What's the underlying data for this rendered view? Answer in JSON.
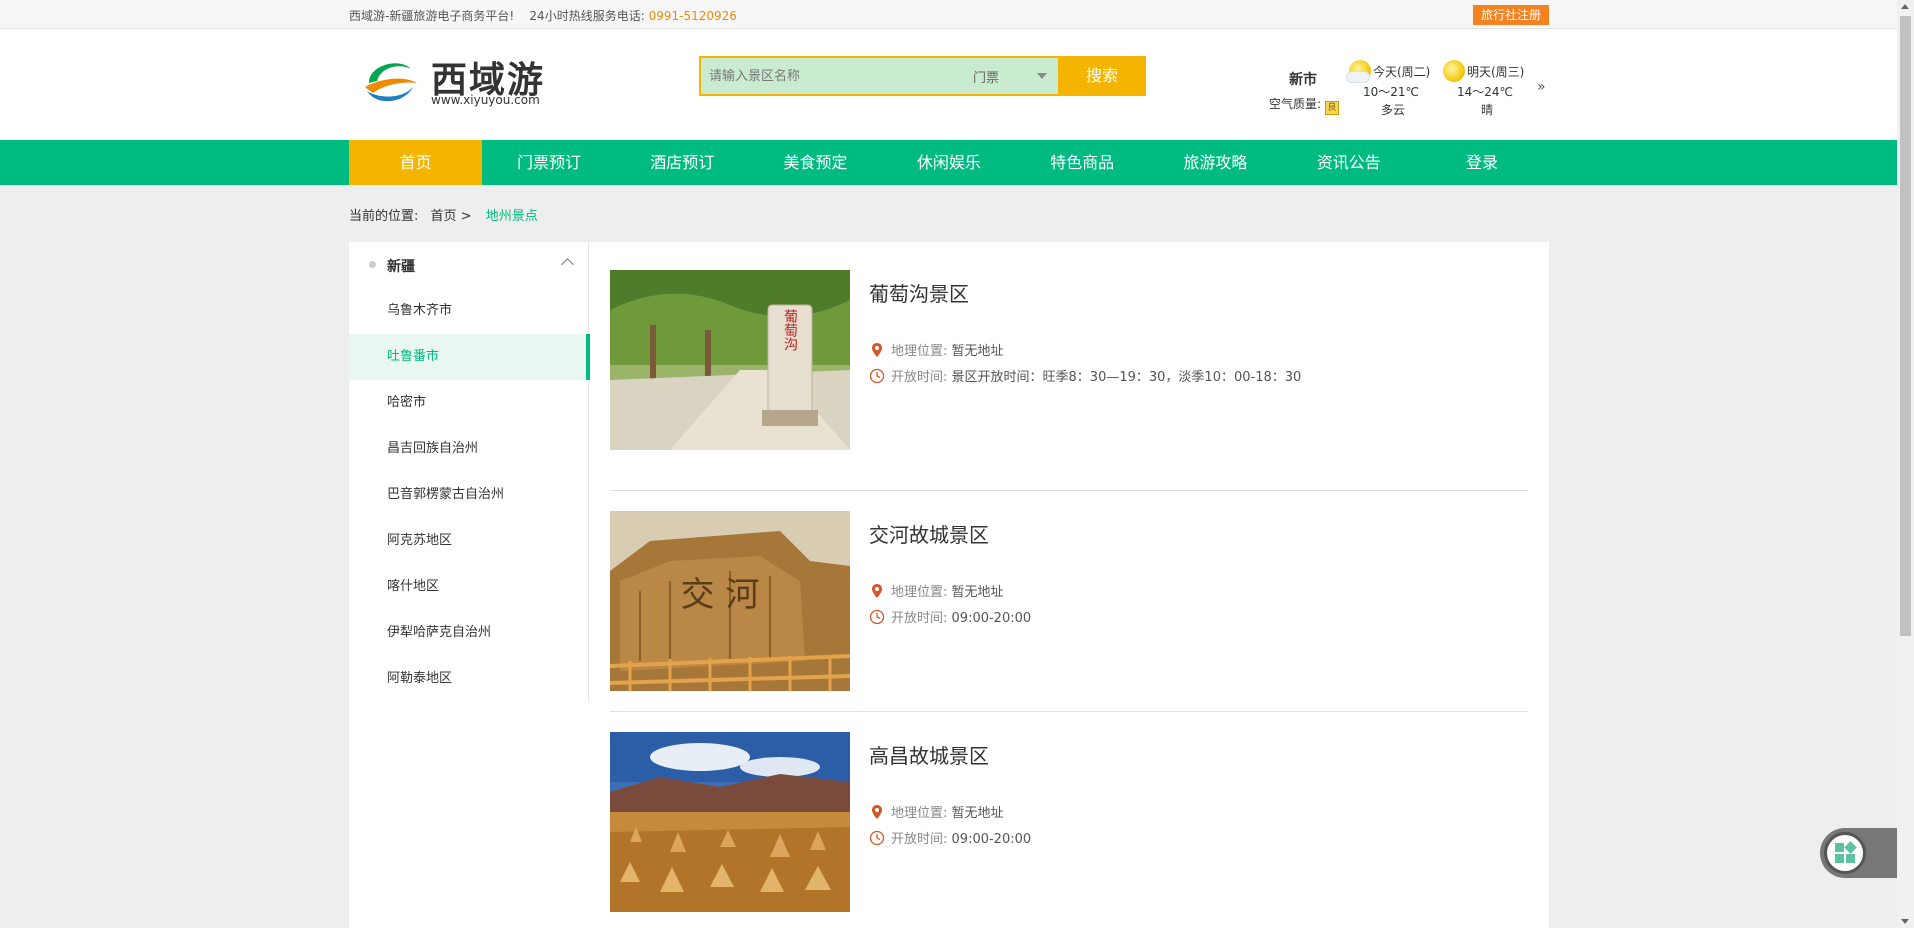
{
  "topbar": {
    "slogan": "西域游-新疆旅游电子商务平台!",
    "hotline_label": "24小时热线服务电话:",
    "hotline_number": "0991-5120926",
    "agency_register": "旅行社注册"
  },
  "header": {
    "logo_text": "西域游",
    "logo_url": "www.xiyuyou.com",
    "search": {
      "placeholder": "请输入景区名称",
      "type_selected": "门票",
      "button": "搜索"
    },
    "city": "新市",
    "air_quality_label": "空气质量:",
    "air_quality_badge": "良",
    "weather": [
      {
        "day": "今天(周二)",
        "temp": "10～21℃",
        "condition": "多云",
        "icon": "cloudy-sun-icon"
      },
      {
        "day": "明天(周三)",
        "temp": "14～24℃",
        "condition": "晴",
        "icon": "sun-icon"
      }
    ],
    "more": "»"
  },
  "nav": {
    "items": [
      "首页",
      "门票预订",
      "酒店预订",
      "美食预定",
      "休闲娱乐",
      "特色商品",
      "旅游攻略",
      "资讯公告",
      "登录"
    ],
    "active_index": 0
  },
  "breadcrumb": {
    "label": "当前的位置:",
    "home": "首页 >",
    "current": "地州景点"
  },
  "sidebar": {
    "region": "新疆",
    "items": [
      "乌鲁木齐市",
      "吐鲁番市",
      "哈密市",
      "昌吉回族自治州",
      "巴音郭楞蒙古自治州",
      "阿克苏地区",
      "喀什地区",
      "伊犁哈萨克自治州",
      "阿勒泰地区"
    ],
    "active_index": 1
  },
  "results": [
    {
      "name": "葡萄沟景区",
      "location_label": "地理位置:",
      "location": "暂无地址",
      "hours_label": "开放时间:",
      "hours": "景区开放时间：旺季8：30—19：30，淡季10：00-18：30",
      "image_text": "葡萄沟"
    },
    {
      "name": "交河故城景区",
      "location_label": "地理位置:",
      "location": "暂无地址",
      "hours_label": "开放时间:",
      "hours": "09:00-20:00",
      "image_text": "交 河"
    },
    {
      "name": "高昌故城景区",
      "location_label": "地理位置:",
      "location": "暂无地址",
      "hours_label": "开放时间:",
      "hours": "09:00-20:00",
      "image_text": ""
    }
  ],
  "colors": {
    "brand_green": "#00bb7f",
    "accent_yellow": "#f4b400",
    "accent_orange": "#f58220"
  }
}
